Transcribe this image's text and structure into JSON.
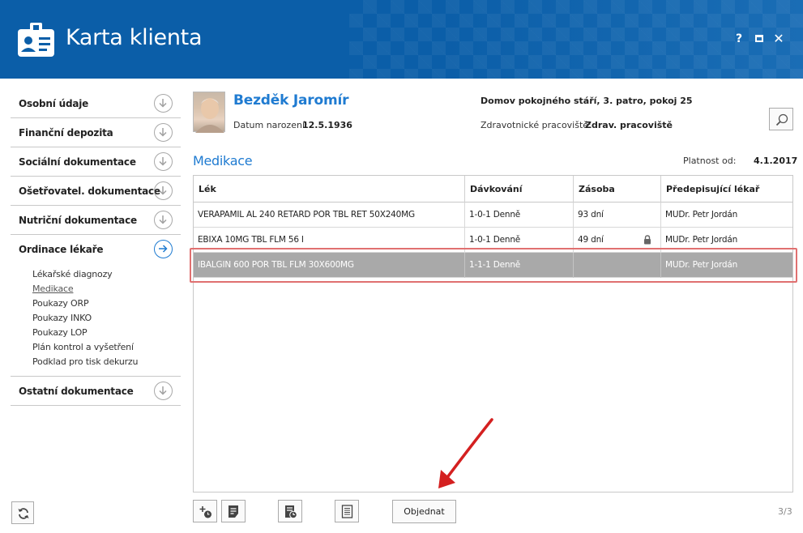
{
  "window": {
    "title": "Karta klienta",
    "controls": {
      "help": "?",
      "close": "✕"
    },
    "accent": "#0b5ea8"
  },
  "sidebar": {
    "items": [
      {
        "label": "Osobní údaje"
      },
      {
        "label": "Finanční depozita"
      },
      {
        "label": "Sociální dokumentace"
      },
      {
        "label": "Ošetřovatel. dokumentace"
      },
      {
        "label": "Nutriční dokumentace"
      },
      {
        "label": "Ordinace lékaře"
      }
    ],
    "subitems": [
      "Lékařské diagnozy",
      "Medikace",
      "Poukazy ORP",
      "Poukazy INKO",
      "Poukazy LOP",
      "Plán kontrol a vyšetření",
      "Podklad pro tisk dekurzu"
    ],
    "last_item": "Ostatní dokumentace"
  },
  "patient": {
    "name": "Bezděk Jaromír",
    "dob_label": "Datum narození:",
    "dob": "12.5.1936",
    "location": "Domov pokojného stáří, 3. patro, pokoj 25",
    "ward_label": "Zdravotnické pracoviště:",
    "ward": "Zdrav. pracoviště"
  },
  "section": {
    "title": "Medikace",
    "valid_label": "Platnost od:",
    "valid_value": "4.1.2017"
  },
  "table": {
    "headers": [
      "Lék",
      "Dávkování",
      "Zásoba",
      "Předepisující lékař"
    ],
    "rows": [
      {
        "drug": "VERAPAMIL AL 240 RETARD POR TBL RET 50X240MG",
        "dosage": "1-0-1 Denně",
        "stock": "93 dní",
        "doctor": "MUDr. Petr Jordán"
      },
      {
        "drug": "EBIXA 10MG TBL FLM 56 I",
        "dosage": "1-0-1 Denně",
        "stock": "49 dní",
        "doctor": "MUDr. Petr Jordán",
        "locked": true
      },
      {
        "drug": "IBALGIN 600 POR TBL FLM 30X600MG",
        "dosage": "1-1-1 Denně",
        "stock": "",
        "doctor": "MUDr. Petr Jordán",
        "selected": true
      }
    ]
  },
  "toolbar": {
    "order_label": "Objednat",
    "pager": "3/3"
  }
}
